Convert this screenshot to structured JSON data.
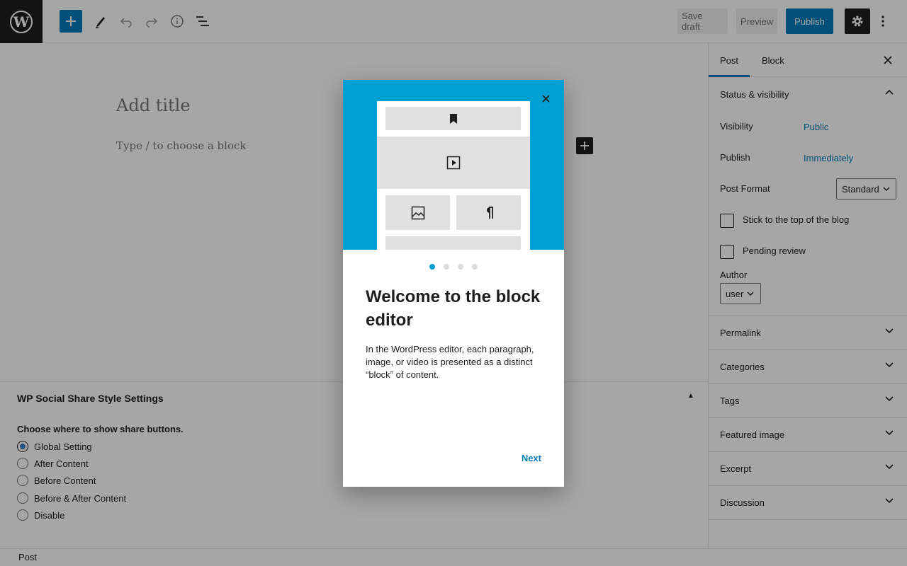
{
  "toolbar": {
    "save_draft": "Save draft",
    "preview": "Preview",
    "publish": "Publish"
  },
  "editor": {
    "title_placeholder": "Add title",
    "block_placeholder": "Type / to choose a block"
  },
  "metabox": {
    "title": "WP Social Share Style Settings",
    "label": "Choose where to show share buttons.",
    "options": [
      "Global Setting",
      "After Content",
      "Before Content",
      "Before & After Content",
      "Disable"
    ],
    "selected": "Global Setting"
  },
  "footer": {
    "breadcrumb": "Post"
  },
  "sidebar": {
    "tabs": [
      "Post",
      "Block"
    ],
    "active_tab": "Post",
    "status_panel": {
      "title": "Status & visibility",
      "visibility_label": "Visibility",
      "visibility_value": "Public",
      "publish_label": "Publish",
      "publish_value": "Immediately",
      "format_label": "Post Format",
      "format_value": "Standard",
      "sticky_label": "Stick to the top of the blog",
      "pending_label": "Pending review",
      "author_label": "Author",
      "author_value": "user"
    },
    "panels": [
      "Permalink",
      "Categories",
      "Tags",
      "Featured image",
      "Excerpt",
      "Discussion"
    ]
  },
  "modal": {
    "title": "Welcome to the block editor",
    "body": "In the WordPress editor, each paragraph, image, or video is presented as a distinct “block” of content.",
    "next": "Next",
    "page_count": 4,
    "current_page": 1
  },
  "colors": {
    "accent": "#007cba",
    "hero": "#00a0d2",
    "dark": "#1e1e1e"
  }
}
